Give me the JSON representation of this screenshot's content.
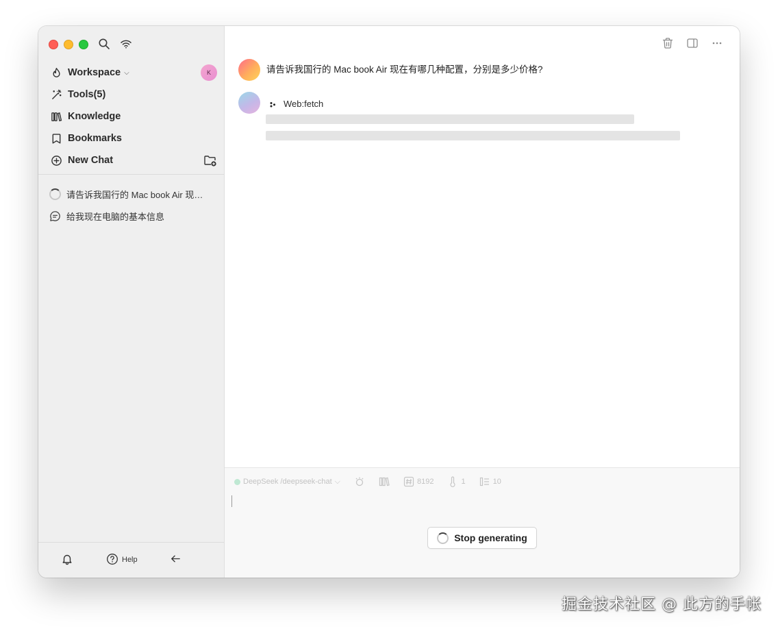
{
  "sidebar": {
    "workspace_label": "Workspace",
    "workspace_avatar_initial": "K",
    "nav": {
      "tools": "Tools(5)",
      "knowledge": "Knowledge",
      "bookmarks": "Bookmarks",
      "new_chat": "New Chat"
    },
    "history": [
      {
        "title": "请告诉我国行的 Mac book Air 现在有哪几种配置，分别是多少价格？",
        "status": "loading"
      },
      {
        "title": "给我现在电脑的基本信息",
        "status": "idle"
      }
    ],
    "bottom": {
      "help_label": "Help"
    }
  },
  "main": {
    "user_message": "请告诉我国行的 Mac book Air 现在有哪几种配置，分别是多少价格?",
    "tool_call": "Web:fetch",
    "composer": {
      "model": "DeepSeek /deepseek-chat",
      "max_tokens": "8192",
      "temperature": "1",
      "context_count": "10",
      "stop_button": "Stop generating"
    }
  },
  "watermark": "掘金技术社区 @ 此方的手帐",
  "colors": {
    "sidebar_bg": "#efefef",
    "traffic_red": "#ff5f57",
    "traffic_yellow": "#febc2e",
    "traffic_green": "#28c840"
  },
  "icons": [
    "search-icon",
    "wifi-icon",
    "flame-icon",
    "magic-wand-icon",
    "books-icon",
    "bookmark-icon",
    "plus-circle-icon",
    "folder-plus-icon",
    "spinner-icon",
    "chat-bubble-icon",
    "bell-icon",
    "help-icon",
    "arrow-left-icon",
    "trash-icon",
    "sidebar-toggle-icon",
    "more-icon"
  ]
}
